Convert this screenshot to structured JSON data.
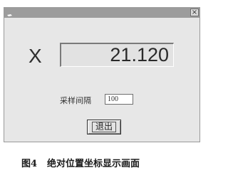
{
  "window": {
    "close_glyph": "×",
    "icons": {
      "system": "window-menu-icon",
      "close": "close-icon"
    }
  },
  "display": {
    "axis_label": "X",
    "position_value": "21.120"
  },
  "sampling": {
    "label": "采样间隔",
    "value": "100"
  },
  "exit_button": {
    "label": "退出"
  },
  "caption": {
    "figure_number": "图4",
    "text": "绝对位置坐标显示画面"
  }
}
